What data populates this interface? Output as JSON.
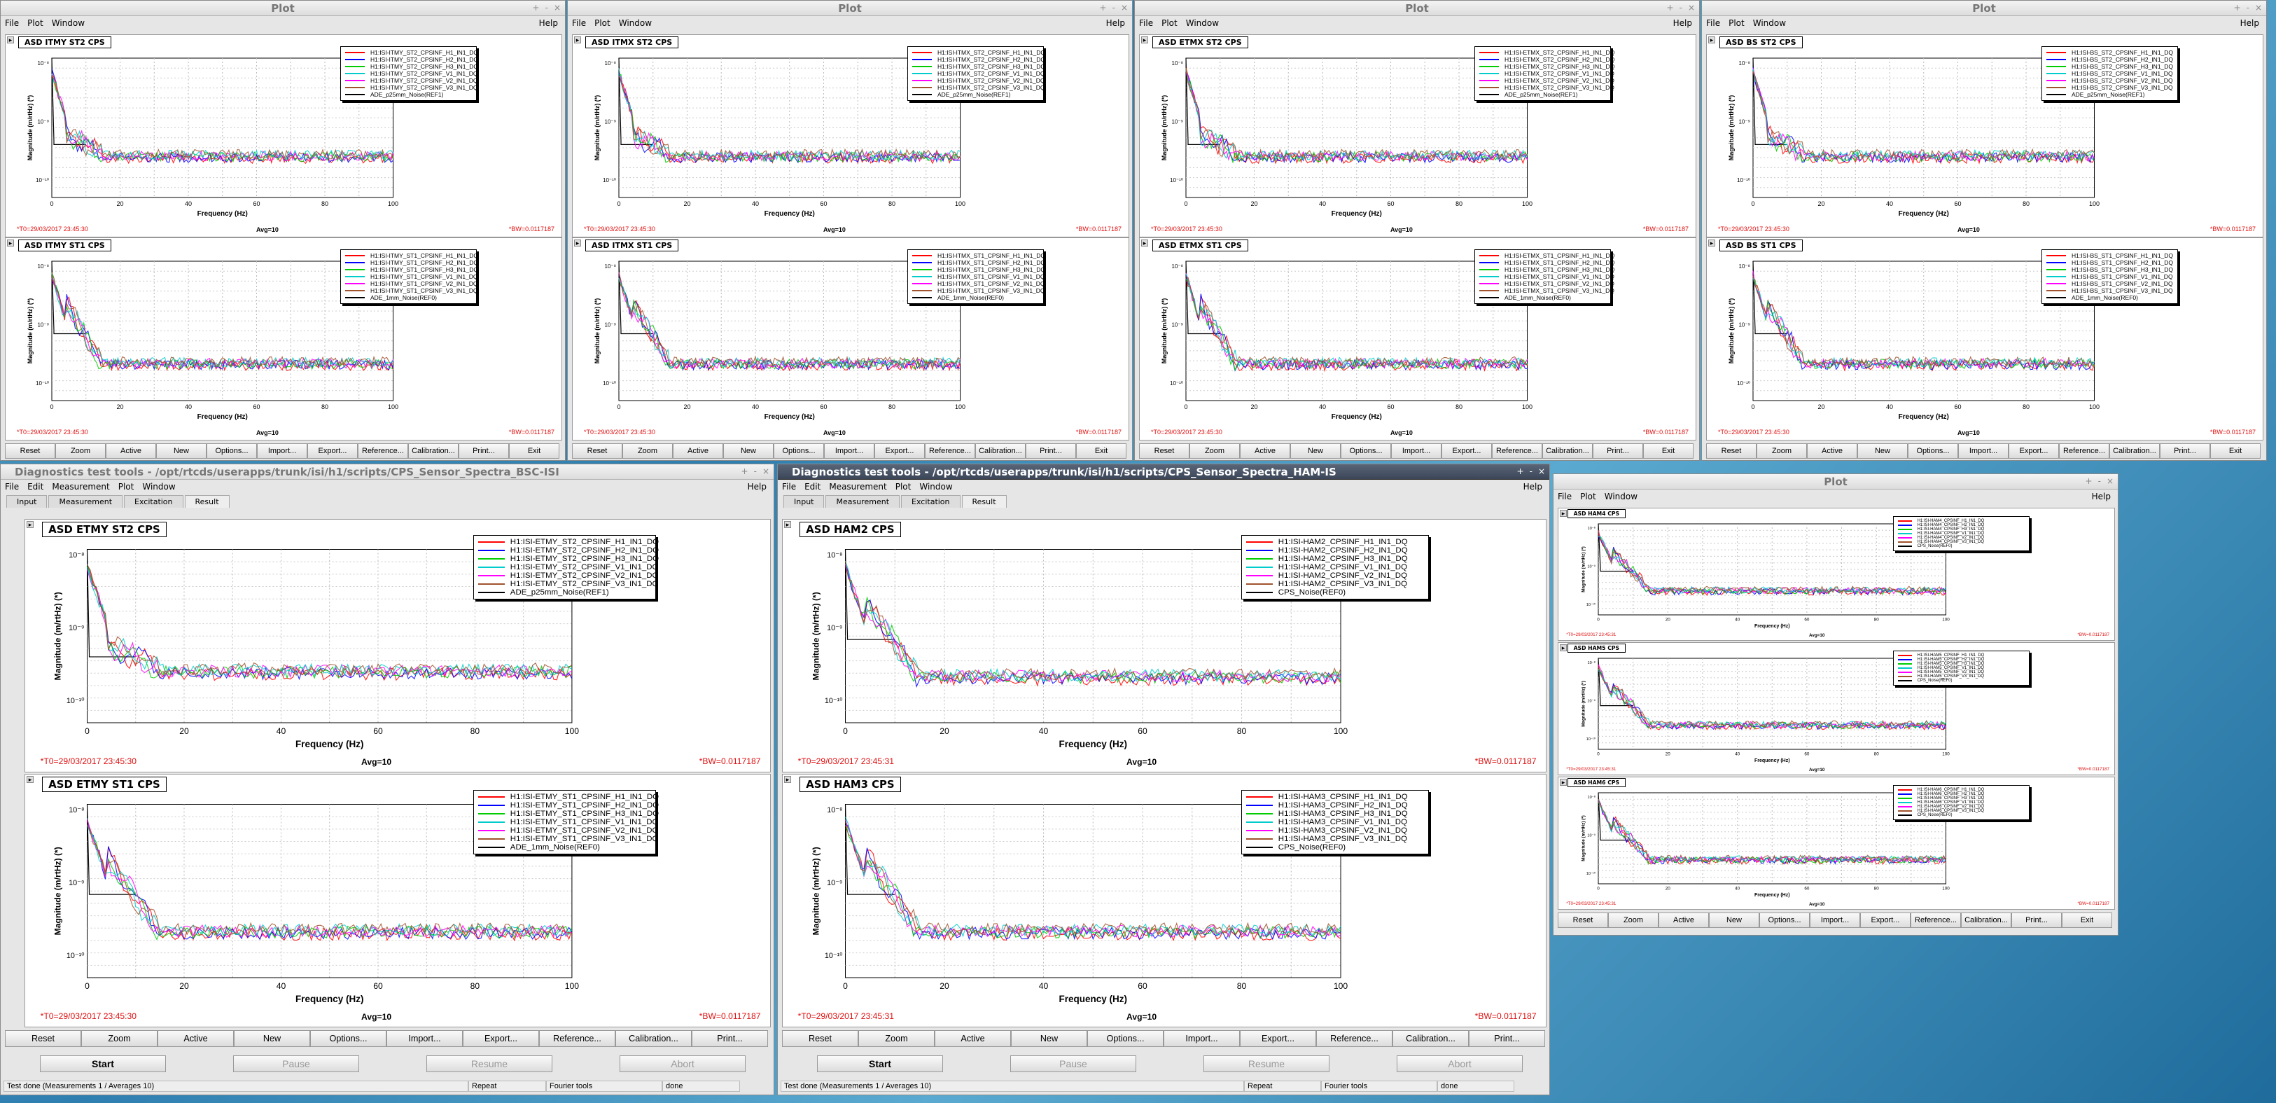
{
  "colors": {
    "red": "#ff0000",
    "green": "#00cc00",
    "blue": "#0000ff",
    "magenta": "#ff00ff",
    "cyan": "#00cccc",
    "brown": "#a0522d",
    "black": "#000000",
    "label_red": "#e01010"
  },
  "plot_window": {
    "title": "Plot",
    "menu": [
      "File",
      "Plot",
      "Window"
    ],
    "help": "Help",
    "controls": [
      "+",
      "-",
      "×"
    ],
    "buttons": [
      "Reset",
      "Zoom",
      "Active",
      "New",
      "Options...",
      "Import...",
      "Export...",
      "Reference...",
      "Calibration...",
      "Print...",
      "Exit"
    ]
  },
  "diag_window": {
    "menu": [
      "File",
      "Edit",
      "Measurement",
      "Plot",
      "Window"
    ],
    "help": "Help",
    "tabs": [
      "Input",
      "Measurement",
      "Excitation",
      "Result"
    ],
    "buttons": [
      "Reset",
      "Zoom",
      "Active",
      "New",
      "Options...",
      "Import...",
      "Export...",
      "Reference...",
      "Calibration...",
      "Print..."
    ],
    "controls": [
      "Start",
      "Pause",
      "Resume",
      "Abort"
    ],
    "status": [
      "Test done (Measurements 1 / Averages 10)",
      "Repeat",
      "Fourier tools",
      "done"
    ]
  },
  "axis": {
    "xlabel": "Frequency (Hz)",
    "ylabel": "Magnitude (m/rtHz) (*)",
    "xticks": [
      "0",
      "20",
      "40",
      "60",
      "80",
      "100"
    ],
    "yticks": [
      "10⁻⁸",
      "10⁻⁹",
      "10⁻¹⁰"
    ]
  },
  "info": {
    "avg": "Avg=10",
    "bw": "*BW=0.0117187",
    "t0_30": "*T0=29/03/2017 23:45:30",
    "t0_31": "*T0=29/03/2017 23:45:31"
  },
  "windows": [
    {
      "title": "Plot",
      "panels": [
        {
          "title": "ASD ITMY ST2 CPS",
          "legend": [
            "H1:ISI-ITMY_ST2_CPSINF_H1_IN1_DQ",
            "H1:ISI-ITMY_ST2_CPSINF_H2_IN1_DQ",
            "H1:ISI-ITMY_ST2_CPSINF_H3_IN1_DQ",
            "H1:ISI-ITMY_ST2_CPSINF_V1_IN1_DQ",
            "H1:ISI-ITMY_ST2_CPSINF_V2_IN1_DQ",
            "H1:ISI-ITMY_ST2_CPSINF_V3_IN1_DQ",
            "ADE_p25mm_Noise(REF1)"
          ]
        },
        {
          "title": "ASD ITMY ST1 CPS",
          "legend": [
            "H1:ISI-ITMY_ST1_CPSINF_H1_IN1_DQ",
            "H1:ISI-ITMY_ST1_CPSINF_H2_IN1_DQ",
            "H1:ISI-ITMY_ST1_CPSINF_H3_IN1_DQ",
            "H1:ISI-ITMY_ST1_CPSINF_V1_IN1_DQ",
            "H1:ISI-ITMY_ST1_CPSINF_V2_IN1_DQ",
            "H1:ISI-ITMY_ST1_CPSINF_V3_IN1_DQ",
            "ADE_1mm_Noise(REF0)"
          ]
        }
      ]
    },
    {
      "title": "Plot",
      "panels": [
        {
          "title": "ASD ITMX ST2 CPS",
          "legend": [
            "H1:ISI-ITMX_ST2_CPSINF_H1_IN1_DQ",
            "H1:ISI-ITMX_ST2_CPSINF_H2_IN1_DQ",
            "H1:ISI-ITMX_ST2_CPSINF_H3_IN1_DQ",
            "H1:ISI-ITMX_ST2_CPSINF_V1_IN1_DQ",
            "H1:ISI-ITMX_ST2_CPSINF_V2_IN1_DQ",
            "H1:ISI-ITMX_ST2_CPSINF_V3_IN1_DQ",
            "ADE_p25mm_Noise(REF1)"
          ]
        },
        {
          "title": "ASD ITMX ST1 CPS",
          "legend": [
            "H1:ISI-ITMX_ST1_CPSINF_H1_IN1_DQ",
            "H1:ISI-ITMX_ST1_CPSINF_H2_IN1_DQ",
            "H1:ISI-ITMX_ST1_CPSINF_H3_IN1_DQ",
            "H1:ISI-ITMX_ST1_CPSINF_V1_IN1_DQ",
            "H1:ISI-ITMX_ST1_CPSINF_V2_IN1_DQ",
            "H1:ISI-ITMX_ST1_CPSINF_V3_IN1_DQ",
            "ADE_1mm_Noise(REF0)"
          ]
        }
      ]
    },
    {
      "title": "Plot",
      "panels": [
        {
          "title": "ASD ETMX ST2 CPS",
          "legend": [
            "H1:ISI-ETMX_ST2_CPSINF_H1_IN1_DQ",
            "H1:ISI-ETMX_ST2_CPSINF_H2_IN1_DQ",
            "H1:ISI-ETMX_ST2_CPSINF_H3_IN1_DQ",
            "H1:ISI-ETMX_ST2_CPSINF_V1_IN1_DQ",
            "H1:ISI-ETMX_ST2_CPSINF_V2_IN1_DQ",
            "H1:ISI-ETMX_ST2_CPSINF_V3_IN1_DQ",
            "ADE_p25mm_Noise(REF1)"
          ]
        },
        {
          "title": "ASD ETMX ST1 CPS",
          "legend": [
            "H1:ISI-ETMX_ST1_CPSINF_H1_IN1_DQ",
            "H1:ISI-ETMX_ST1_CPSINF_H2_IN1_DQ",
            "H1:ISI-ETMX_ST1_CPSINF_H3_IN1_DQ",
            "H1:ISI-ETMX_ST1_CPSINF_V1_IN1_DQ",
            "H1:ISI-ETMX_ST1_CPSINF_V2_IN1_DQ",
            "H1:ISI-ETMX_ST1_CPSINF_V3_IN1_DQ",
            "ADE_1mm_Noise(REF0)"
          ]
        }
      ]
    },
    {
      "title": "Plot",
      "panels": [
        {
          "title": "ASD BS ST2 CPS",
          "legend": [
            "H1:ISI-BS_ST2_CPSINF_H1_IN1_DQ",
            "H1:ISI-BS_ST2_CPSINF_H2_IN1_DQ",
            "H1:ISI-BS_ST2_CPSINF_H3_IN1_DQ",
            "H1:ISI-BS_ST2_CPSINF_V1_IN1_DQ",
            "H1:ISI-BS_ST2_CPSINF_V2_IN1_DQ",
            "H1:ISI-BS_ST2_CPSINF_V3_IN1_DQ",
            "ADE_p25mm_Noise(REF1)"
          ]
        },
        {
          "title": "ASD BS ST1 CPS",
          "legend": [
            "H1:ISI-BS_ST1_CPSINF_H1_IN1_DQ",
            "H1:ISI-BS_ST1_CPSINF_H2_IN1_DQ",
            "H1:ISI-BS_ST1_CPSINF_H3_IN1_DQ",
            "H1:ISI-BS_ST1_CPSINF_V1_IN1_DQ",
            "H1:ISI-BS_ST1_CPSINF_V2_IN1_DQ",
            "H1:ISI-BS_ST1_CPSINF_V3_IN1_DQ",
            "ADE_1mm_Noise(REF0)"
          ]
        }
      ]
    },
    {
      "title": "Diagnostics test tools - /opt/rtcds/userapps/trunk/isi/h1/scripts/CPS_Sensor_Spectra_BSC-ISI",
      "panels": [
        {
          "title": "ASD ETMY ST2 CPS",
          "legend": [
            "H1:ISI-ETMY_ST2_CPSINF_H1_IN1_DQ",
            "H1:ISI-ETMY_ST2_CPSINF_H2_IN1_DQ",
            "H1:ISI-ETMY_ST2_CPSINF_H3_IN1_DQ",
            "H1:ISI-ETMY_ST2_CPSINF_V1_IN1_DQ",
            "H1:ISI-ETMY_ST2_CPSINF_V2_IN1_DQ",
            "H1:ISI-ETMY_ST2_CPSINF_V3_IN1_DQ",
            "ADE_p25mm_Noise(REF1)"
          ]
        },
        {
          "title": "ASD ETMY ST1 CPS",
          "legend": [
            "H1:ISI-ETMY_ST1_CPSINF_H1_IN1_DQ",
            "H1:ISI-ETMY_ST1_CPSINF_H2_IN1_DQ",
            "H1:ISI-ETMY_ST1_CPSINF_H3_IN1_DQ",
            "H1:ISI-ETMY_ST1_CPSINF_V1_IN1_DQ",
            "H1:ISI-ETMY_ST1_CPSINF_V2_IN1_DQ",
            "H1:ISI-ETMY_ST1_CPSINF_V3_IN1_DQ",
            "ADE_1mm_Noise(REF0)"
          ]
        }
      ]
    },
    {
      "title": "Diagnostics test tools - /opt/rtcds/userapps/trunk/isi/h1/scripts/CPS_Sensor_Spectra_HAM-IS",
      "panels": [
        {
          "title": "ASD HAM2 CPS",
          "legend": [
            "H1:ISI-HAM2_CPSINF_H1_IN1_DQ",
            "H1:ISI-HAM2_CPSINF_H2_IN1_DQ",
            "H1:ISI-HAM2_CPSINF_H3_IN1_DQ",
            "H1:ISI-HAM2_CPSINF_V1_IN1_DQ",
            "H1:ISI-HAM2_CPSINF_V2_IN1_DQ",
            "H1:ISI-HAM2_CPSINF_V3_IN1_DQ",
            "CPS_Noise(REF0)"
          ]
        },
        {
          "title": "ASD HAM3 CPS",
          "legend": [
            "H1:ISI-HAM3_CPSINF_H1_IN1_DQ",
            "H1:ISI-HAM3_CPSINF_H2_IN1_DQ",
            "H1:ISI-HAM3_CPSINF_H3_IN1_DQ",
            "H1:ISI-HAM3_CPSINF_V1_IN1_DQ",
            "H1:ISI-HAM3_CPSINF_V2_IN1_DQ",
            "H1:ISI-HAM3_CPSINF_V3_IN1_DQ",
            "CPS_Noise(REF0)"
          ]
        }
      ]
    },
    {
      "title": "Plot",
      "panels": [
        {
          "title": "ASD HAM4 CPS",
          "legend": [
            "H1:ISI-HAM4_CPSINF_H1_IN1_DQ",
            "H1:ISI-HAM4_CPSINF_H2_IN1_DQ",
            "H1:ISI-HAM4_CPSINF_H3_IN1_DQ",
            "H1:ISI-HAM4_CPSINF_V1_IN1_DQ",
            "H1:ISI-HAM4_CPSINF_V2_IN1_DQ",
            "H1:ISI-HAM4_CPSINF_V3_IN1_DQ",
            "CPS_Noise(REF0)"
          ]
        },
        {
          "title": "ASD HAM5 CPS",
          "legend": [
            "H1:ISI-HAM5_CPSINF_H1_IN1_DQ",
            "H1:ISI-HAM5_CPSINF_H2_IN1_DQ",
            "H1:ISI-HAM5_CPSINF_H3_IN1_DQ",
            "H1:ISI-HAM5_CPSINF_V1_IN1_DQ",
            "H1:ISI-HAM5_CPSINF_V2_IN1_DQ",
            "H1:ISI-HAM5_CPSINF_V3_IN1_DQ",
            "CPS_Noise(REF0)"
          ]
        },
        {
          "title": "ASD HAM6 CPS",
          "legend": [
            "H1:ISI-HAM6_CPSINF_H1_IN1_DQ",
            "H1:ISI-HAM6_CPSINF_H2_IN1_DQ",
            "H1:ISI-HAM6_CPSINF_H3_IN1_DQ",
            "H1:ISI-HAM6_CPSINF_V1_IN1_DQ",
            "H1:ISI-HAM6_CPSINF_V2_IN1_DQ",
            "H1:ISI-HAM6_CPSINF_V3_IN1_DQ",
            "CPS_Noise(REF0)"
          ]
        }
      ]
    }
  ]
}
